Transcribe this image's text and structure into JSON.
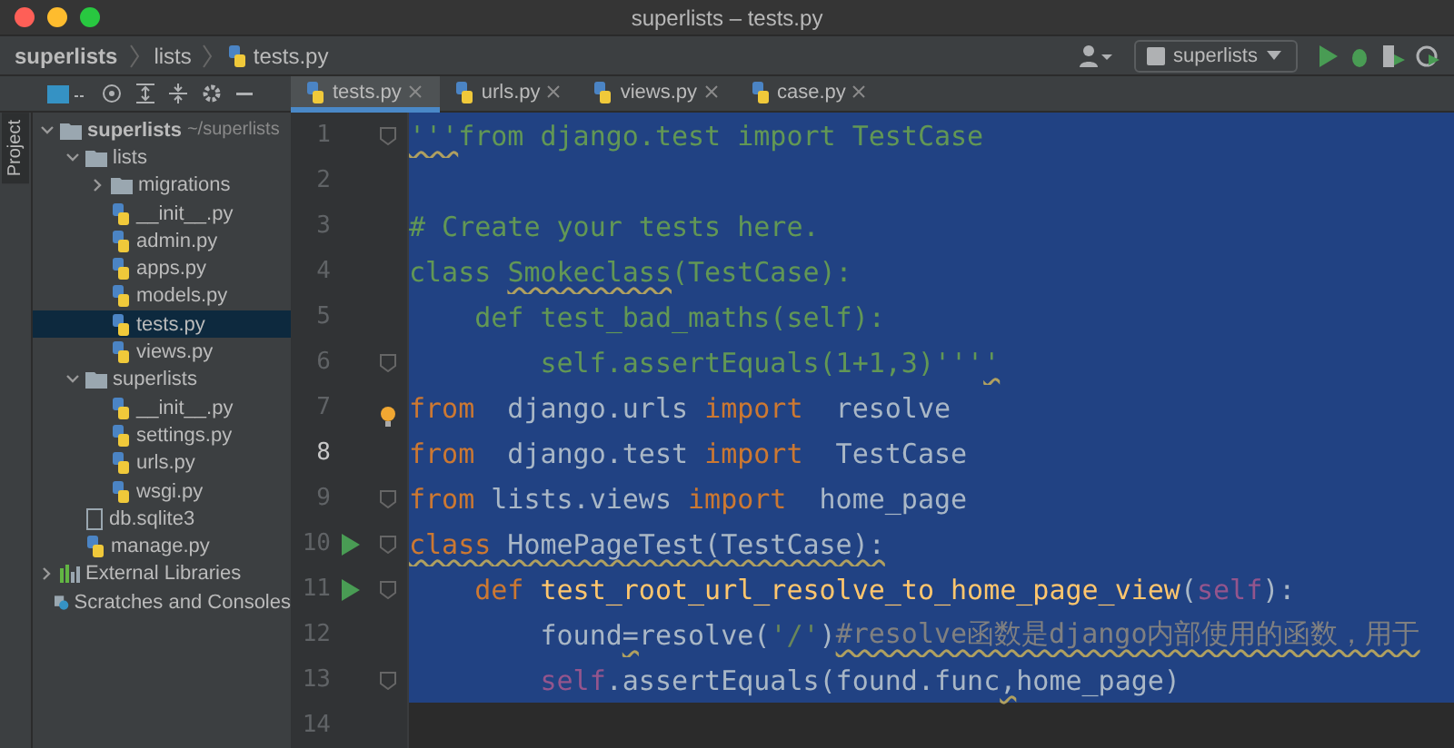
{
  "window": {
    "title": "superlists – tests.py"
  },
  "breadcrumb": [
    "superlists",
    "lists",
    "tests.py"
  ],
  "run_config": {
    "label": "superlists"
  },
  "side_stripe": {
    "label": "Project"
  },
  "project_tree": [
    {
      "label": "superlists",
      "hint": "~/superlists",
      "kind": "folder",
      "expanded": true,
      "selected": false,
      "children": [
        {
          "label": "lists",
          "kind": "folder",
          "expanded": true,
          "selected": false,
          "children": [
            {
              "label": "migrations",
              "kind": "folder",
              "expanded": false,
              "selected": false
            },
            {
              "label": "__init__.py",
              "kind": "python",
              "selected": false
            },
            {
              "label": "admin.py",
              "kind": "python",
              "selected": false
            },
            {
              "label": "apps.py",
              "kind": "python",
              "selected": false
            },
            {
              "label": "models.py",
              "kind": "python",
              "selected": false
            },
            {
              "label": "tests.py",
              "kind": "python",
              "selected": true
            },
            {
              "label": "views.py",
              "kind": "python",
              "selected": false
            }
          ]
        },
        {
          "label": "superlists",
          "kind": "folder",
          "expanded": true,
          "selected": false,
          "children": [
            {
              "label": "__init__.py",
              "kind": "python",
              "selected": false
            },
            {
              "label": "settings.py",
              "kind": "python",
              "selected": false
            },
            {
              "label": "urls.py",
              "kind": "python",
              "selected": false
            },
            {
              "label": "wsgi.py",
              "kind": "python",
              "selected": false
            }
          ]
        },
        {
          "label": "db.sqlite3",
          "kind": "db",
          "selected": false
        },
        {
          "label": "manage.py",
          "kind": "python",
          "selected": false
        }
      ]
    },
    {
      "label": "External Libraries",
      "kind": "libraries",
      "expanded": false,
      "selected": false
    },
    {
      "label": "Scratches and Consoles",
      "kind": "scratches",
      "selected": false
    }
  ],
  "tabs": [
    {
      "label": "tests.py",
      "selected": true
    },
    {
      "label": "urls.py",
      "selected": false
    },
    {
      "label": "views.py",
      "selected": false
    },
    {
      "label": "case.py",
      "selected": false
    }
  ],
  "editor": {
    "lines": [
      {
        "number": "1",
        "selected": true,
        "current": false,
        "fold_marker": true,
        "tokens": [
          {
            "text": "'''",
            "kind": "doc",
            "squiggle": true
          },
          {
            "text": "from django.test import TestCase",
            "kind": "doc",
            "squiggle": false
          }
        ]
      },
      {
        "number": "2",
        "selected": true,
        "current": false
      },
      {
        "number": "3",
        "selected": true,
        "current": false,
        "tokens": [
          {
            "text": "# Create your tests here.",
            "kind": "doc",
            "squiggle": false
          }
        ]
      },
      {
        "number": "4",
        "selected": true,
        "current": false,
        "tokens": [
          {
            "text": "class ",
            "kind": "doc",
            "squiggle": false
          },
          {
            "text": "Smokeclass",
            "kind": "doc",
            "squiggle": true
          },
          {
            "text": "(TestCase):",
            "kind": "doc",
            "squiggle": false
          }
        ]
      },
      {
        "number": "5",
        "selected": true,
        "current": false,
        "tokens": [
          {
            "text": "    def test_bad_maths(self):",
            "kind": "doc",
            "squiggle": false
          }
        ]
      },
      {
        "number": "6",
        "selected": true,
        "current": false,
        "fold_marker": true,
        "tokens": [
          {
            "text": "        self.assertEquals(1+1,3)'''",
            "kind": "doc",
            "squiggle": false
          },
          {
            "text": "'",
            "kind": "doc",
            "squiggle": true
          }
        ]
      },
      {
        "number": "7",
        "selected": true,
        "current": false,
        "bulb": true,
        "tokens": [
          {
            "text": "from",
            "kind": "keyword",
            "squiggle": false
          },
          {
            "text": "  django.urls ",
            "kind": "plain",
            "squiggle": false
          },
          {
            "text": "import",
            "kind": "keyword",
            "squiggle": false
          },
          {
            "text": "  resolve",
            "kind": "plain",
            "squiggle": false
          }
        ]
      },
      {
        "number": "8",
        "selected": true,
        "current": true,
        "tokens": [
          {
            "text": "from",
            "kind": "keyword",
            "squiggle": false
          },
          {
            "text": "  django.test ",
            "kind": "plain",
            "squiggle": false
          },
          {
            "text": "import",
            "kind": "keyword",
            "squiggle": false
          },
          {
            "text": "  TestCase",
            "kind": "plain",
            "squiggle": false
          }
        ]
      },
      {
        "number": "9",
        "selected": true,
        "current": false,
        "fold_marker": true,
        "tokens": [
          {
            "text": "from",
            "kind": "keyword",
            "squiggle": false
          },
          {
            "text": " lists.views ",
            "kind": "plain",
            "squiggle": false
          },
          {
            "text": "import",
            "kind": "keyword",
            "squiggle": false
          },
          {
            "text": "  home_page",
            "kind": "plain",
            "squiggle": false
          }
        ]
      },
      {
        "number": "10",
        "selected": true,
        "current": false,
        "run_button": true,
        "fold_marker": true,
        "tokens": [
          {
            "text": "class",
            "kind": "keyword",
            "squiggle": true
          },
          {
            "text": " HomePageTest(TestCase):",
            "kind": "plain",
            "squiggle": true
          }
        ]
      },
      {
        "number": "11",
        "selected": true,
        "current": false,
        "run_button": true,
        "fold_marker": true,
        "tokens": [
          {
            "text": "    def ",
            "kind": "keyword",
            "squiggle": false
          },
          {
            "text": "test_root_url_resolve_to_home_page_view",
            "kind": "function",
            "squiggle": false
          },
          {
            "text": "(",
            "kind": "plain",
            "squiggle": false
          },
          {
            "text": "self",
            "kind": "self",
            "squiggle": false
          },
          {
            "text": "):",
            "kind": "plain",
            "squiggle": false
          }
        ]
      },
      {
        "number": "12",
        "selected": true,
        "current": false,
        "tokens": [
          {
            "text": "        found",
            "kind": "plain",
            "squiggle": false
          },
          {
            "text": "=",
            "kind": "plain",
            "squiggle": true
          },
          {
            "text": "resolve(",
            "kind": "plain",
            "squiggle": false
          },
          {
            "text": "'/'",
            "kind": "string",
            "squiggle": false
          },
          {
            "text": ")",
            "kind": "plain",
            "squiggle": false
          },
          {
            "text": "#resolve函数是django内部使用的函数，用于",
            "kind": "comment",
            "squiggle": true
          }
        ]
      },
      {
        "number": "13",
        "selected": true,
        "current": false,
        "fold_marker": true,
        "tokens": [
          {
            "text": "        self",
            "kind": "self",
            "squiggle": false
          },
          {
            "text": ".assertEquals(found.func",
            "kind": "plain",
            "squiggle": false
          },
          {
            "text": ",",
            "kind": "plain",
            "squiggle": true
          },
          {
            "text": "home_page)",
            "kind": "plain",
            "squiggle": false
          }
        ]
      },
      {
        "number": "14",
        "selected": false,
        "current": false
      }
    ]
  }
}
